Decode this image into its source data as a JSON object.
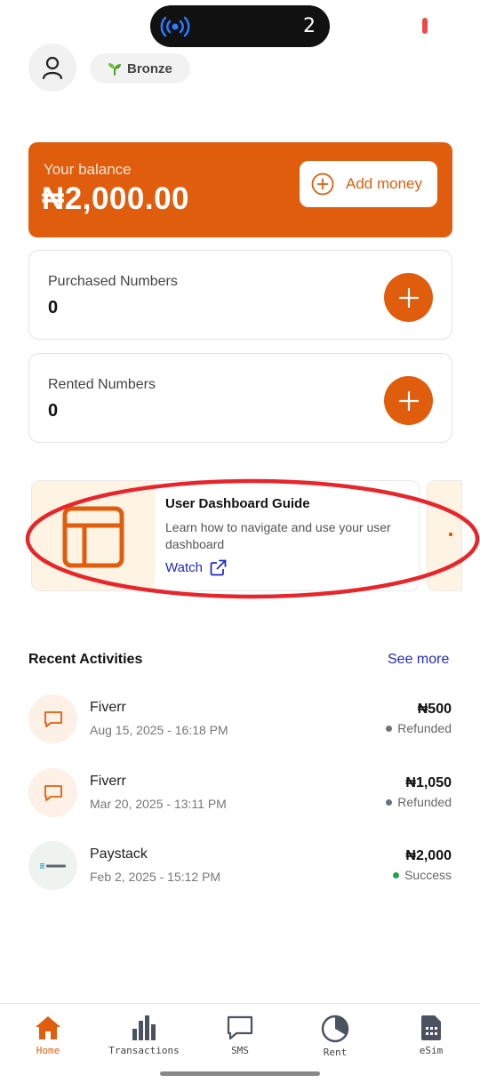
{
  "status": {
    "island_count": "2"
  },
  "header": {
    "tier_icon": "seedling-icon",
    "tier_label": "Bronze"
  },
  "balance": {
    "label": "Your balance",
    "amount": "₦2,000.00",
    "add_money_label": "Add money"
  },
  "purchased": {
    "title": "Purchased Numbers",
    "value": "0"
  },
  "rented": {
    "title": "Rented Numbers",
    "value": "0"
  },
  "guide": {
    "title": "User Dashboard Guide",
    "description": "Learn how to navigate and use your user dashboard",
    "watch_label": "Watch"
  },
  "recent": {
    "title": "Recent Activities",
    "see_more": "See more",
    "items": [
      {
        "name": "Fiverr",
        "date": "Aug 15, 2025 - 16:18 PM",
        "amount": "₦500",
        "status": "Refunded",
        "icon": "message-icon"
      },
      {
        "name": "Fiverr",
        "date": "Mar 20, 2025 - 13:11 PM",
        "amount": "₦1,050",
        "status": "Refunded",
        "icon": "message-icon"
      },
      {
        "name": "Paystack",
        "date": "Feb 2, 2025 - 15:12 PM",
        "amount": "₦2,000",
        "status": "Success",
        "icon": "paystack-logo"
      }
    ]
  },
  "nav": {
    "items": [
      {
        "label": "Home",
        "icon": "home-icon",
        "active": true
      },
      {
        "label": "Transactions",
        "icon": "bar-chart-icon",
        "active": false
      },
      {
        "label": "SMS",
        "icon": "message-icon",
        "active": false
      },
      {
        "label": "Rent",
        "icon": "pie-chart-icon",
        "active": false
      },
      {
        "label": "eSim",
        "icon": "sim-card-icon",
        "active": false
      }
    ]
  },
  "colors": {
    "accent": "#e05d0e",
    "link": "#2228c8",
    "annotation": "#e8252b",
    "success": "#23a34b"
  }
}
